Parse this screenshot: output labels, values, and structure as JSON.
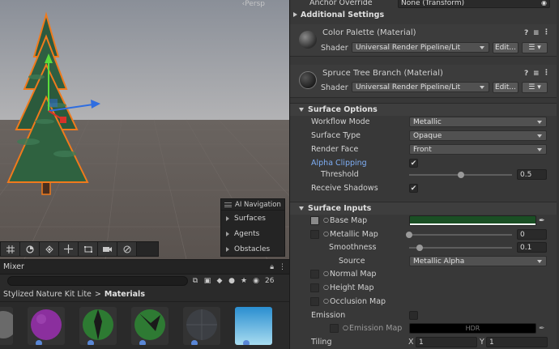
{
  "scene": {
    "persp_label": "‹Persp",
    "toolbar_icons": [
      "grid-icon",
      "orbit-icon",
      "nav-icon",
      "move-icon",
      "rect-icon",
      "camera-icon",
      "compass-icon"
    ]
  },
  "ai_navigation": {
    "title": "AI Navigation",
    "items": [
      {
        "label": "Surfaces"
      },
      {
        "label": "Agents"
      },
      {
        "label": "Obstacles"
      }
    ]
  },
  "project": {
    "tab_label": "Mixer",
    "count": "26",
    "breadcrumb_parent": "Stylized Nature Kit Lite",
    "breadcrumb_sep": ">",
    "breadcrumb_current": "Materials",
    "thumb_colors": [
      "#5a5a5a",
      "#8a2a9a",
      "#2a6a2a",
      "#2f6f2f",
      "#3b3b3b",
      "#6fbfe0"
    ]
  },
  "inspector": {
    "anchor_override_label": "Anchor Override",
    "anchor_override_value": "None (Transform)",
    "additional_settings_label": "Additional Settings",
    "materials": [
      {
        "title": "Color Palette (Material)",
        "shader_label": "Shader",
        "shader_value": "Universal Render Pipeline/Lit",
        "edit_label": "Edit...",
        "help_icon": "?",
        "more_icon": "⋮"
      },
      {
        "title": "Spruce Tree Branch (Material)",
        "shader_label": "Shader",
        "shader_value": "Universal Render Pipeline/Lit",
        "edit_label": "Edit...",
        "help_icon": "?",
        "more_icon": "⋮"
      }
    ],
    "surface_options": {
      "header": "Surface Options",
      "workflow_mode_label": "Workflow Mode",
      "workflow_mode_value": "Metallic",
      "surface_type_label": "Surface Type",
      "surface_type_value": "Opaque",
      "render_face_label": "Render Face",
      "render_face_value": "Front",
      "alpha_clipping_label": "Alpha Clipping",
      "alpha_clipping_checked": "✔",
      "threshold_label": "Threshold",
      "threshold_value": "0.5",
      "threshold_fraction": 0.5,
      "receive_shadows_label": "Receive Shadows",
      "receive_shadows_checked": "✔"
    },
    "surface_inputs": {
      "header": "Surface Inputs",
      "base_map_label": "Base Map",
      "base_map_color": "#1a4f24",
      "metallic_map_label": "Metallic Map",
      "metallic_value": "0",
      "metallic_fraction": 0,
      "smoothness_label": "Smoothness",
      "smoothness_value": "0.1",
      "smoothness_fraction": 0.1,
      "source_label": "Source",
      "source_value": "Metallic Alpha",
      "normal_map_label": "Normal Map",
      "height_map_label": "Height Map",
      "occlusion_map_label": "Occlusion Map",
      "emission_label": "Emission",
      "emission_map_label": "Emission Map",
      "emission_hdr_label": "HDR",
      "tiling_label": "Tiling",
      "tiling_x_label": "X",
      "tiling_x_value": "1",
      "tiling_y_label": "Y",
      "tiling_y_value": "1"
    }
  }
}
